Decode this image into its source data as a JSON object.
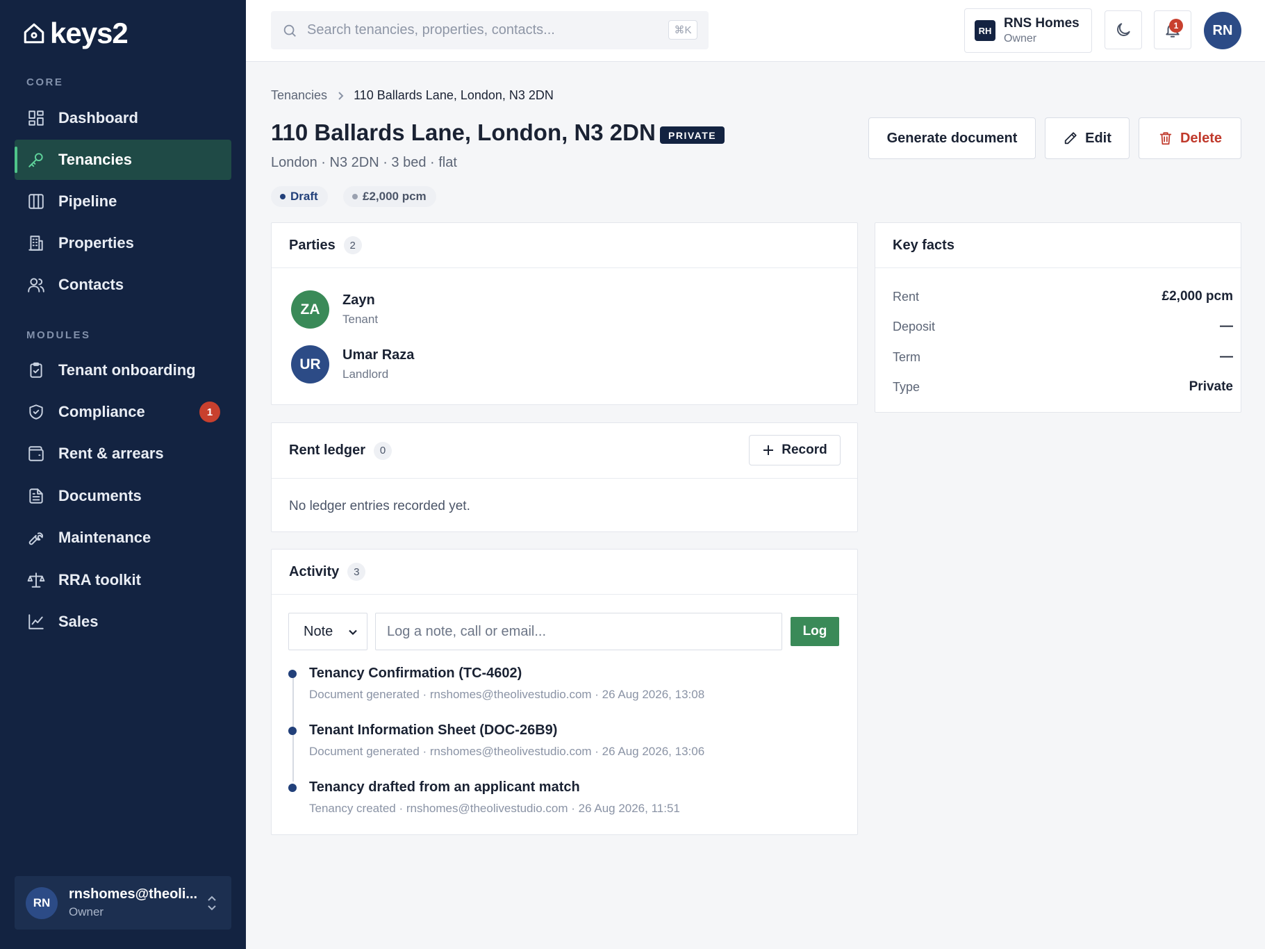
{
  "app": {
    "name": "keys2"
  },
  "sidebar": {
    "sections": [
      {
        "label": "CORE",
        "items": [
          {
            "label": "Dashboard",
            "icon": "dashboard-icon"
          },
          {
            "label": "Tenancies",
            "icon": "key-icon",
            "active": true
          },
          {
            "label": "Pipeline",
            "icon": "columns-icon"
          },
          {
            "label": "Properties",
            "icon": "building-icon"
          },
          {
            "label": "Contacts",
            "icon": "users-icon"
          }
        ]
      },
      {
        "label": "MODULES",
        "items": [
          {
            "label": "Tenant onboarding",
            "icon": "clipboard-icon"
          },
          {
            "label": "Compliance",
            "icon": "shield-icon",
            "badge": "1"
          },
          {
            "label": "Rent & arrears",
            "icon": "wallet-icon"
          },
          {
            "label": "Documents",
            "icon": "document-icon"
          },
          {
            "label": "Maintenance",
            "icon": "wrench-icon"
          },
          {
            "label": "RRA toolkit",
            "icon": "scales-icon"
          },
          {
            "label": "Sales",
            "icon": "chart-line-icon"
          }
        ]
      }
    ],
    "user": {
      "initials": "RN",
      "name": "rnshomes@theoli...",
      "role": "Owner"
    }
  },
  "topbar": {
    "search_placeholder": "Search tenancies, properties, contacts...",
    "search_shortcut": "⌘K",
    "org": {
      "initials": "RH",
      "name": "RNS Homes",
      "role": "Owner"
    },
    "notification_count": "1",
    "avatar_initials": "RN"
  },
  "breadcrumb": {
    "parent": "Tenancies",
    "current": "110 Ballards Lane, London, N3 2DN"
  },
  "header": {
    "title": "110 Ballards Lane, London, N3 2DN",
    "type_badge": "PRIVATE",
    "subtitle": "London · N3 2DN · 3 bed · flat",
    "status_chip": "Draft",
    "rent_chip": "£2,000 pcm",
    "actions": {
      "generate": "Generate document",
      "edit": "Edit",
      "delete": "Delete"
    }
  },
  "colors": {
    "sidebar_bg": "#132341",
    "accent_green": "#3a8a58",
    "danger": "#c0392b",
    "badge_red": "#c8402e"
  },
  "parties": {
    "title": "Parties",
    "count": "2",
    "items": [
      {
        "initials": "ZA",
        "name": "Zayn",
        "role": "Tenant",
        "color": "#3a8a58"
      },
      {
        "initials": "UR",
        "name": "Umar Raza",
        "role": "Landlord",
        "color": "#2c4b86"
      }
    ]
  },
  "ledger": {
    "title": "Rent ledger",
    "count": "0",
    "record_label": "Record",
    "empty": "No ledger entries recorded yet."
  },
  "activity": {
    "title": "Activity",
    "count": "3",
    "type_select": "Note",
    "input_placeholder": "Log a note, call or email...",
    "log_label": "Log",
    "items": [
      {
        "title": "Tenancy Confirmation (TC-4602)",
        "meta": "Document generated · rnshomes@theolivestudio.com · 26 Aug 2026, 13:08"
      },
      {
        "title": "Tenant Information Sheet (DOC-26B9)",
        "meta": "Document generated · rnshomes@theolivestudio.com · 26 Aug 2026, 13:06"
      },
      {
        "title": "Tenancy drafted from an applicant match",
        "meta": "Tenancy created · rnshomes@theolivestudio.com · 26 Aug 2026, 11:51"
      }
    ]
  },
  "key_facts": {
    "title": "Key facts",
    "rows": [
      {
        "label": "Rent",
        "value": "£2,000 pcm"
      },
      {
        "label": "Deposit",
        "value": "—"
      },
      {
        "label": "Term",
        "value": "—"
      },
      {
        "label": "Type",
        "value": "Private"
      }
    ]
  }
}
